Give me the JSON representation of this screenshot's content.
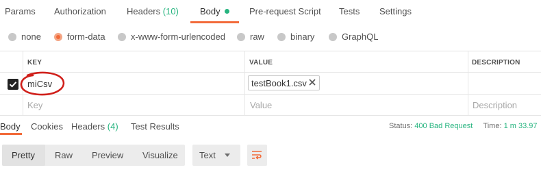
{
  "request_tabs": {
    "params": "Params",
    "authorization": "Authorization",
    "headers_label": "Headers",
    "headers_count": "(10)",
    "body": "Body",
    "prerequest": "Pre-request Script",
    "tests": "Tests",
    "settings": "Settings",
    "active": "Body"
  },
  "body_types": {
    "options": [
      "none",
      "form-data",
      "x-www-form-urlencoded",
      "raw",
      "binary",
      "GraphQL"
    ],
    "selected": "form-data"
  },
  "params_table": {
    "headers": {
      "key": "KEY",
      "value": "VALUE",
      "description": "DESCRIPTION"
    },
    "rows": [
      {
        "checked": true,
        "key": "miCsv",
        "file": "testBook1.csv"
      }
    ],
    "placeholders": {
      "key": "Key",
      "value": "Value",
      "description": "Description"
    }
  },
  "response_tabs": {
    "body": "Body",
    "cookies": "Cookies",
    "headers_label": "Headers",
    "headers_count": "(4)",
    "test_results": "Test Results",
    "status_label": "Status:",
    "status_value": "400 Bad Request",
    "time_label": "Time:",
    "time_value": "1 m 33.97"
  },
  "response_view": {
    "modes": [
      "Pretty",
      "Raw",
      "Preview",
      "Visualize"
    ],
    "active_mode": "Pretty",
    "format": "Text"
  },
  "colors": {
    "accent": "#f26b3a",
    "success": "#26b47f",
    "annotation": "#d0201b"
  }
}
